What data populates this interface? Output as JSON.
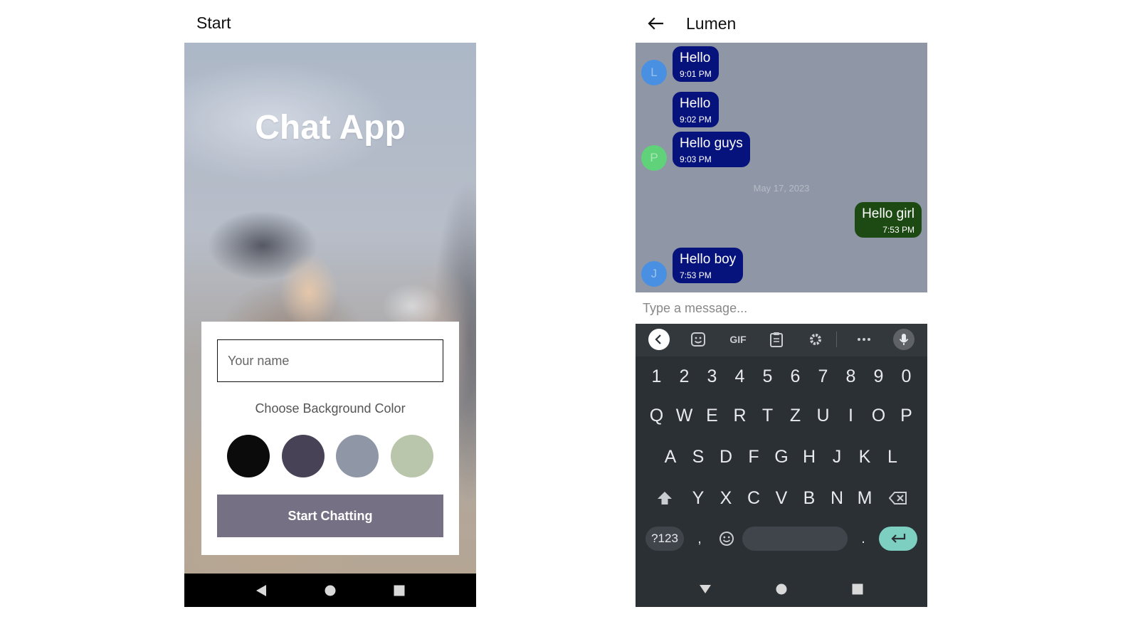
{
  "left_screen": {
    "title": "Start",
    "app_title": "Chat App",
    "name_input": {
      "placeholder": "Your name",
      "value": ""
    },
    "color_label": "Choose Background Color",
    "color_options": [
      "#0b0b0b",
      "#484256",
      "#8f96a5",
      "#bac6ab"
    ],
    "start_button_label": "Start Chatting",
    "start_button_color": "#757084"
  },
  "right_screen": {
    "title": "Lumen",
    "chat_background": "#8f96a5",
    "messages": [
      {
        "text": "Hello",
        "time": "9:01 PM",
        "side": "left",
        "avatar": "L"
      },
      {
        "text": "Hello",
        "time": "9:02 PM",
        "side": "left"
      },
      {
        "text": "Hello guys",
        "time": "9:03 PM",
        "side": "left",
        "avatar": "P"
      },
      {
        "text": "Hello girl",
        "time": "7:53 PM",
        "side": "right"
      },
      {
        "text": "Hello boy",
        "time": "7:53 PM",
        "side": "left",
        "avatar": "J"
      }
    ],
    "date_separator": "May 17, 2023",
    "message_input": {
      "placeholder": "Type a message...",
      "value": ""
    },
    "colors": {
      "incoming_bubble": "#07137c",
      "outgoing_bubble": "#1d4a13",
      "avatar_blue": "#4a90e2",
      "avatar_green": "#5fd27a"
    }
  },
  "keyboard": {
    "toolbar": {
      "gif_label": "GIF",
      "icons": [
        "back-icon",
        "sticker-icon",
        "gif-icon",
        "clipboard-icon",
        "settings-icon",
        "more-icon",
        "mic-icon"
      ]
    },
    "number_row": [
      "1",
      "2",
      "3",
      "4",
      "5",
      "6",
      "7",
      "8",
      "9",
      "0"
    ],
    "row1": [
      "Q",
      "W",
      "E",
      "R",
      "T",
      "Z",
      "U",
      "I",
      "O",
      "P"
    ],
    "row2": [
      "A",
      "S",
      "D",
      "F",
      "G",
      "H",
      "J",
      "K",
      "L"
    ],
    "row3": [
      "Y",
      "X",
      "C",
      "V",
      "B",
      "N",
      "M"
    ],
    "symbols_label": "?123",
    "comma": ",",
    "period": ".",
    "enter_color": "#7dcfc2"
  }
}
